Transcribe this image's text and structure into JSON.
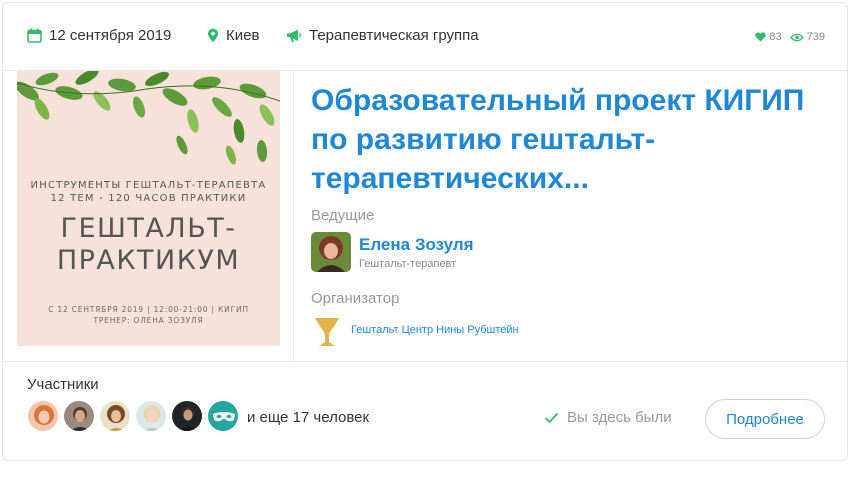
{
  "meta": {
    "date": "12 сентября 2019",
    "city": "Киев",
    "event_type": "Терапевтическая группа",
    "likes": "83",
    "views": "739"
  },
  "poster": {
    "subtitle_line1": "ИНСТРУМЕНТЫ ГЕШТАЛЬТ-ТЕРАПЕВТА",
    "subtitle_line2": "12 ТЕМ - 120 ЧАСОВ ПРАКТИКИ",
    "title_line1": "ГЕШТАЛЬТ-",
    "title_line2": "ПРАКТИКУМ",
    "footer_line1": "С 12 СЕНТЯБРЯ 2019 | 12:00-21:00 | КИГИП",
    "footer_line2": "ТРЕНЕР: ОЛЕНА ЗОЗУЛЯ"
  },
  "event": {
    "title": "Образовательный проект КИГИП по развитию гештальт-терапевтических..."
  },
  "host": {
    "label": "Ведущие",
    "name": "Елена Зозуля",
    "role": "Гештальт-терапевт"
  },
  "organizer": {
    "label": "Организатор",
    "name": "Гештальт Центр Нины Рубштейн"
  },
  "participants": {
    "label": "Участники",
    "more_text": "и еще 17 человек",
    "been_here": "Вы здесь были",
    "details_button": "Подробнее"
  },
  "colors": {
    "accent": "#1e88d6",
    "green": "#2ebc6a",
    "poster_bg": "#f7e2da"
  }
}
